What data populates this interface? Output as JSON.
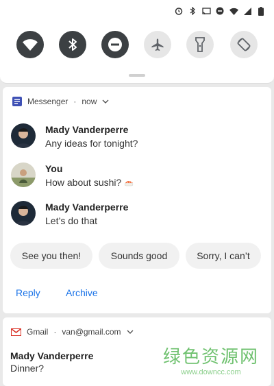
{
  "status_bar": {
    "icons": [
      "alarm-icon",
      "bluetooth-icon",
      "cast-icon",
      "dnd-icon",
      "wifi-icon",
      "signal-icon",
      "battery-icon"
    ]
  },
  "quick_settings": {
    "tiles": [
      {
        "name": "wifi",
        "state": "on"
      },
      {
        "name": "bluetooth",
        "state": "on"
      },
      {
        "name": "do-not-disturb",
        "state": "on"
      },
      {
        "name": "airplane-mode",
        "state": "off"
      },
      {
        "name": "flashlight",
        "state": "off"
      },
      {
        "name": "auto-rotate",
        "state": "off"
      }
    ]
  },
  "messenger": {
    "app_name": "Messenger",
    "time": "now",
    "messages": [
      {
        "sender": "Mady Vanderperre",
        "text": "Any ideas for tonight?"
      },
      {
        "sender": "You",
        "text": "How about sushi?"
      },
      {
        "sender": "Mady Vanderperre",
        "text": "Let’s do that"
      }
    ],
    "smart_replies": [
      "See you then!",
      "Sounds good",
      "Sorry, I can’t"
    ],
    "actions": {
      "reply": "Reply",
      "archive": "Archive"
    },
    "accent": "#1a73e8"
  },
  "gmail": {
    "app_name": "Gmail",
    "account": "van@gmail.com",
    "sender": "Mady Vanderperre",
    "preview": "Dinner?"
  },
  "watermark": {
    "title": "绿色资源网",
    "url": "www.downcc.com"
  }
}
